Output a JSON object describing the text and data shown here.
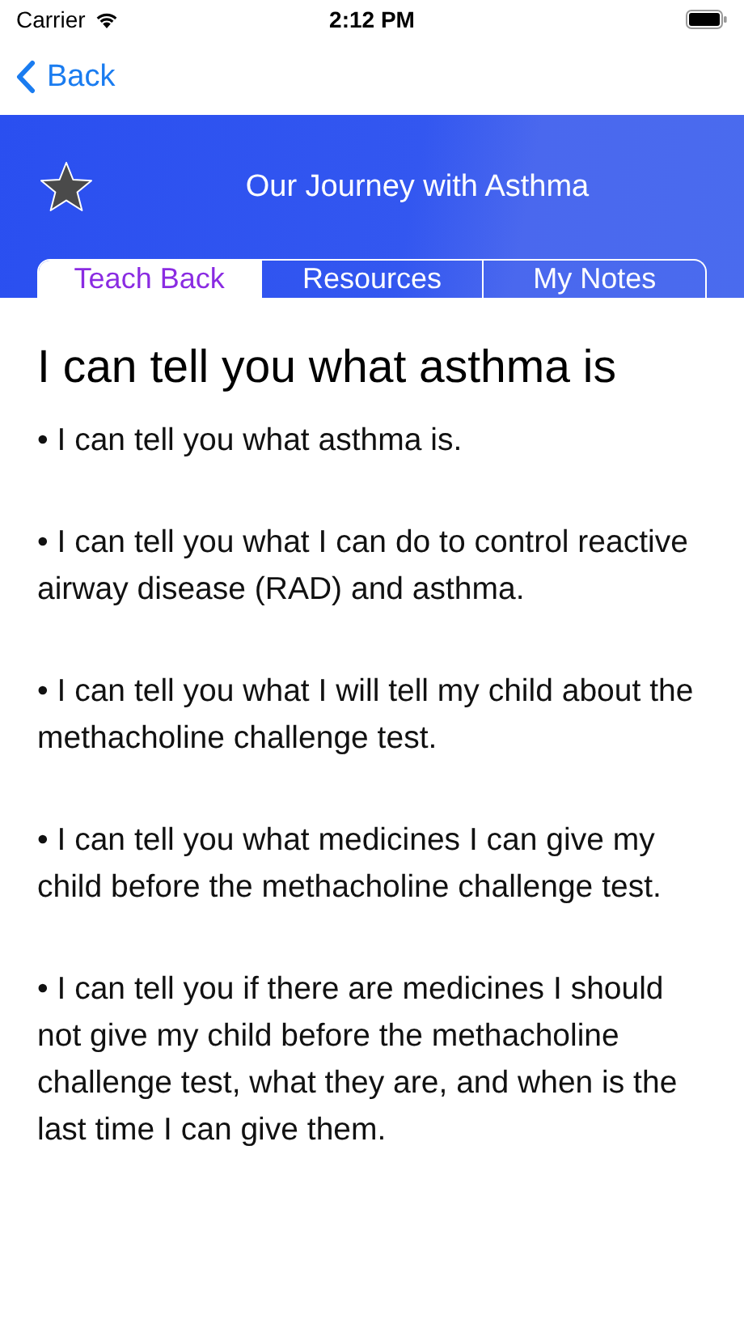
{
  "status_bar": {
    "carrier": "Carrier",
    "time": "2:12 PM"
  },
  "nav": {
    "back": "Back"
  },
  "header": {
    "title": "Our Journey with Asthma"
  },
  "tabs": [
    {
      "label": "Teach Back",
      "selected": true
    },
    {
      "label": "Resources",
      "selected": false
    },
    {
      "label": "My Notes",
      "selected": false
    }
  ],
  "content": {
    "heading": "I can tell you what asthma is",
    "items": [
      "• I can tell you what asthma is.",
      "• I can tell you what I can do to control reactive airway disease (RAD) and asthma.",
      "• I can tell you what I will tell my child about the methacholine challenge test.",
      "• I can tell you what medicines I can give my child before the methacholine challenge test.",
      "• I can tell you if there are medicines I should not give my child before the methacholine challenge test, what they are, and when is the last time I can give them."
    ]
  }
}
